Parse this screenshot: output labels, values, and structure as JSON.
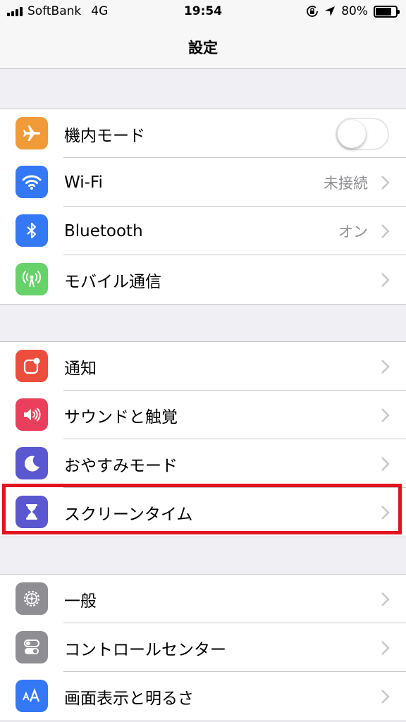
{
  "status_bar": {
    "carrier": "SoftBank",
    "network": "4G",
    "time": "19:54",
    "battery_percent": "80%",
    "battery_level": 0.8,
    "icons": [
      "signal-icon",
      "orientation-lock-icon",
      "location-arrow-icon",
      "battery-icon"
    ]
  },
  "nav": {
    "title": "設定"
  },
  "groups": [
    {
      "rows": [
        {
          "label": "機内モード",
          "icon": "airplane-icon",
          "icon_color": "#f19a38",
          "accessory": "toggle",
          "toggle_on": false
        },
        {
          "label": "Wi-Fi",
          "icon": "wifi-icon",
          "icon_color": "#3478f6",
          "detail": "未接続",
          "accessory": "chevron"
        },
        {
          "label": "Bluetooth",
          "icon": "bluetooth-icon",
          "icon_color": "#3478f6",
          "detail": "オン",
          "accessory": "chevron"
        },
        {
          "label": "モバイル通信",
          "icon": "antenna-icon",
          "icon_color": "#66d269",
          "accessory": "chevron"
        }
      ]
    },
    {
      "rows": [
        {
          "label": "通知",
          "icon": "notifications-icon",
          "icon_color": "#ec4d3d",
          "accessory": "chevron"
        },
        {
          "label": "サウンドと触覚",
          "icon": "speaker-icon",
          "icon_color": "#ea3f5c",
          "accessory": "chevron"
        },
        {
          "label": "おやすみモード",
          "icon": "moon-icon",
          "icon_color": "#5a57d0",
          "accessory": "chevron"
        },
        {
          "label": "スクリーンタイム",
          "icon": "hourglass-icon",
          "icon_color": "#5a57d0",
          "accessory": "chevron",
          "highlighted": true
        }
      ]
    },
    {
      "rows": [
        {
          "label": "一般",
          "icon": "gear-icon",
          "icon_color": "#8e8e93",
          "accessory": "chevron"
        },
        {
          "label": "コントロールセンター",
          "icon": "switches-icon",
          "icon_color": "#8e8e93",
          "accessory": "chevron"
        },
        {
          "label": "画面表示と明るさ",
          "icon": "text-size-icon",
          "icon_color": "#3478f6",
          "accessory": "chevron"
        }
      ]
    }
  ],
  "colors": {
    "highlight_border": "#e2131f",
    "background": "#efeff4"
  }
}
